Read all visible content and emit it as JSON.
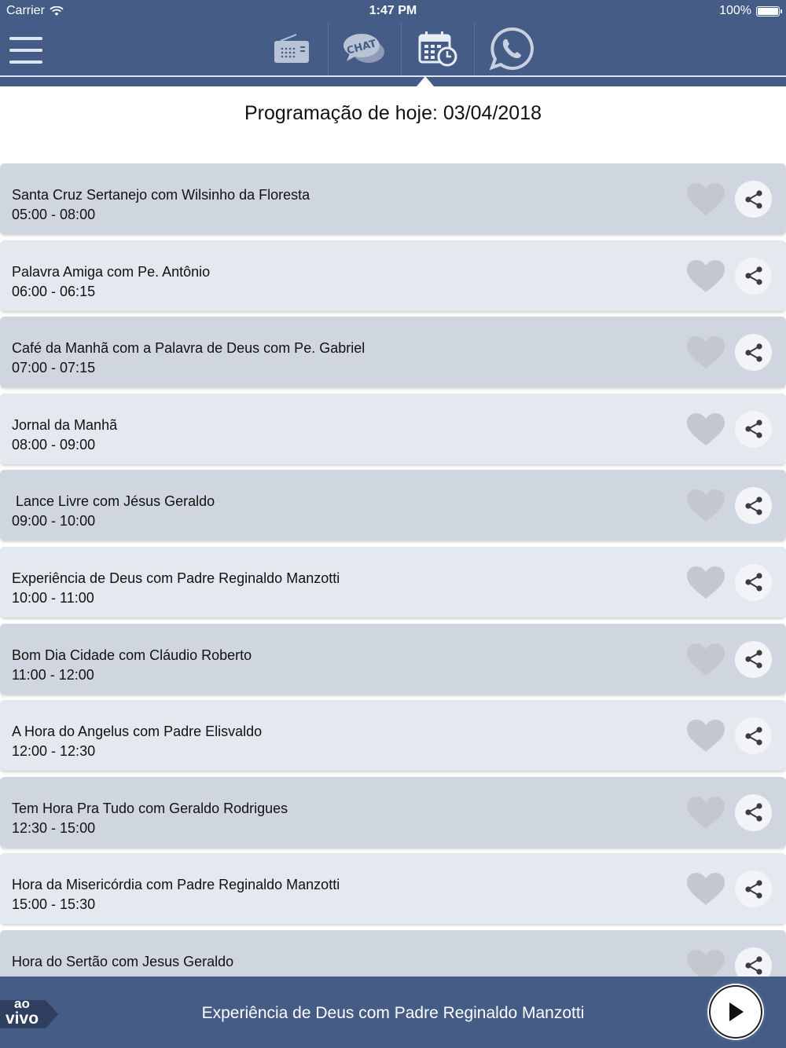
{
  "status_bar": {
    "carrier": "Carrier",
    "time": "1:47 PM",
    "battery": "100%",
    "battery_level": 1.0
  },
  "header": {
    "tabs": [
      {
        "icon": "radio-icon",
        "label": ""
      },
      {
        "icon": "chat-icon",
        "label": "CHAT"
      },
      {
        "icon": "calendar-schedule-icon",
        "label": "",
        "selected": true
      },
      {
        "icon": "whatsapp-icon",
        "label": ""
      }
    ]
  },
  "page": {
    "title": "Programação de hoje: 03/04/2018"
  },
  "schedule": [
    {
      "title": "Santa Cruz Sertanejo com Wilsinho da Floresta",
      "start": "05:00",
      "end": "08:00",
      "hours": "05:00  -  08:00"
    },
    {
      "title": "Palavra Amiga com Pe. Antônio",
      "start": "06:00",
      "end": "06:15",
      "hours": "06:00  -  06:15"
    },
    {
      "title": "Café da Manhã com a Palavra de Deus com Pe. Gabriel",
      "start": "07:00",
      "end": "07:15",
      "hours": "07:00  -  07:15"
    },
    {
      "title": "Jornal da Manhã",
      "start": "08:00",
      "end": "09:00",
      "hours": "08:00  -  09:00"
    },
    {
      "title": " Lance Livre com Jésus Geraldo",
      "start": "09:00",
      "end": "10:00",
      "hours": "09:00  -  10:00"
    },
    {
      "title": "Experiência de Deus com Padre Reginaldo Manzotti",
      "start": "10:00",
      "end": "11:00",
      "hours": "10:00  -  11:00"
    },
    {
      "title": "Bom Dia Cidade com Cláudio Roberto",
      "start": "11:00",
      "end": "12:00",
      "hours": "11:00  -  12:00"
    },
    {
      "title": "A Hora do Angelus com Padre Elisvaldo",
      "start": "12:00",
      "end": "12:30",
      "hours": "12:00  -  12:30"
    },
    {
      "title": "Tem Hora Pra Tudo com Geraldo Rodrigues",
      "start": "12:30",
      "end": "15:00",
      "hours": "12:30  -  15:00"
    },
    {
      "title": "Hora da Misericórdia com Padre Reginaldo Manzotti",
      "start": "15:00",
      "end": "15:30",
      "hours": "15:00  -  15:30"
    },
    {
      "title": "Hora do Sertão com Jesus Geraldo",
      "start": "",
      "end": "",
      "hours": ""
    }
  ],
  "player": {
    "live_badge_top": "ao",
    "live_badge_bottom": "vivo",
    "now_playing": "Experiência de Deus com Padre Reginaldo Manzotti"
  },
  "colors": {
    "header_bg": "#455c87",
    "row_dark": "#d0d6df",
    "row_light": "#e4e8ef",
    "heart_gray": "#c4c8ce"
  }
}
